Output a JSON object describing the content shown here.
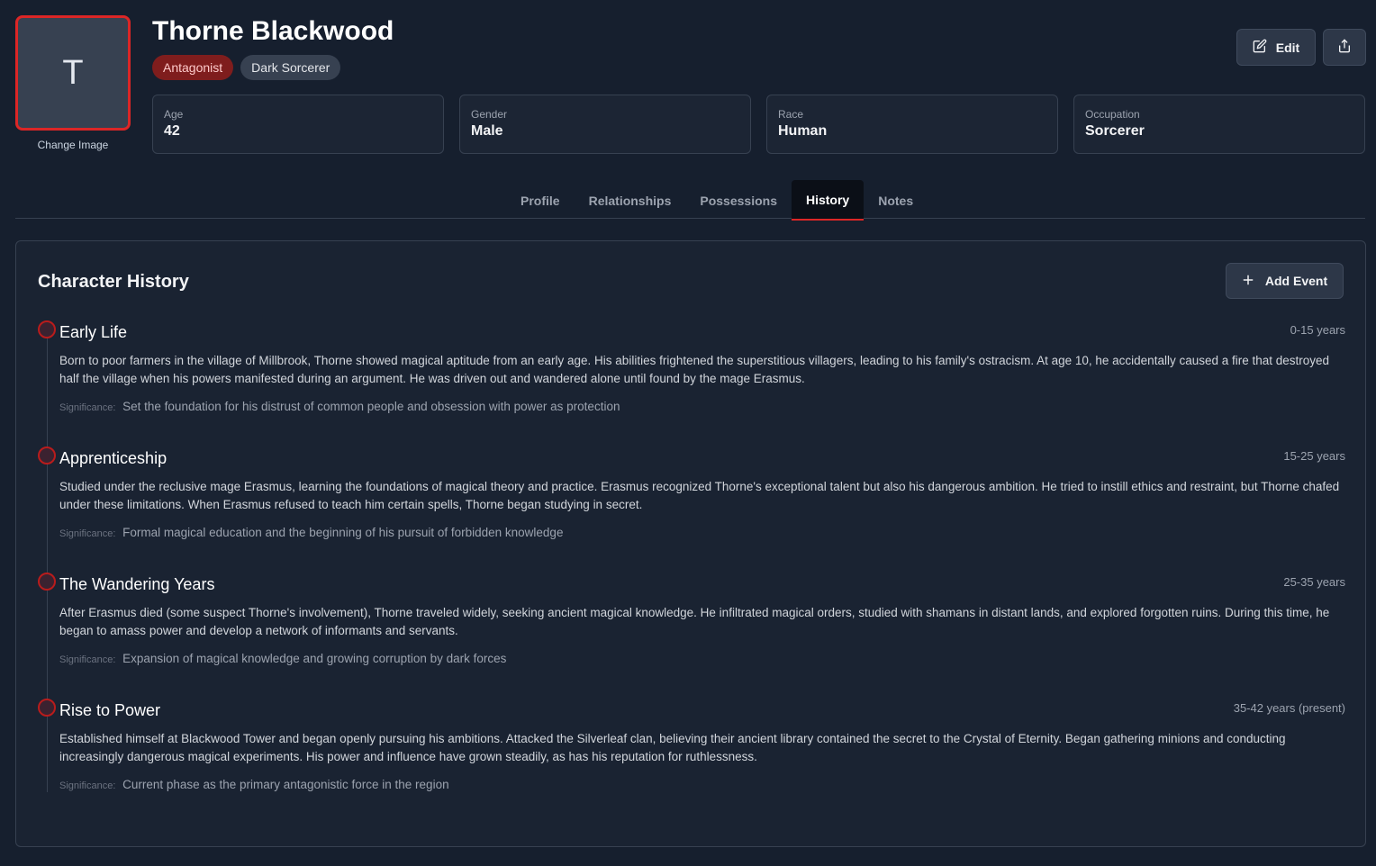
{
  "character": {
    "avatar_initial": "T",
    "change_image": "Change Image",
    "name": "Thorne Blackwood",
    "tags": [
      "Antagonist",
      "Dark Sorcerer"
    ],
    "stats": [
      {
        "label": "Age",
        "value": "42"
      },
      {
        "label": "Gender",
        "value": "Male"
      },
      {
        "label": "Race",
        "value": "Human"
      },
      {
        "label": "Occupation",
        "value": "Sorcerer"
      }
    ]
  },
  "actions": {
    "edit_label": "Edit",
    "edit_icon": "edit-icon",
    "share_icon": "share-icon"
  },
  "tabs": [
    {
      "label": "Profile",
      "active": false
    },
    {
      "label": "Relationships",
      "active": false
    },
    {
      "label": "Possessions",
      "active": false
    },
    {
      "label": "History",
      "active": true
    },
    {
      "label": "Notes",
      "active": false
    }
  ],
  "history": {
    "title": "Character History",
    "add_label": "Add Event",
    "significance_label": "Significance:",
    "events": [
      {
        "title": "Early Life",
        "period": "0-15 years",
        "description": "Born to poor farmers in the village of Millbrook, Thorne showed magical aptitude from an early age. His abilities frightened the superstitious villagers, leading to his family's ostracism. At age 10, he accidentally caused a fire that destroyed half the village when his powers manifested during an argument. He was driven out and wandered alone until found by the mage Erasmus.",
        "significance": "Set the foundation for his distrust of common people and obsession with power as protection"
      },
      {
        "title": "Apprenticeship",
        "period": "15-25 years",
        "description": "Studied under the reclusive mage Erasmus, learning the foundations of magical theory and practice. Erasmus recognized Thorne's exceptional talent but also his dangerous ambition. He tried to instill ethics and restraint, but Thorne chafed under these limitations. When Erasmus refused to teach him certain spells, Thorne began studying in secret.",
        "significance": "Formal magical education and the beginning of his pursuit of forbidden knowledge"
      },
      {
        "title": "The Wandering Years",
        "period": "25-35 years",
        "description": "After Erasmus died (some suspect Thorne's involvement), Thorne traveled widely, seeking ancient magical knowledge. He infiltrated magical orders, studied with shamans in distant lands, and explored forgotten ruins. During this time, he began to amass power and develop a network of informants and servants.",
        "significance": "Expansion of magical knowledge and growing corruption by dark forces"
      },
      {
        "title": "Rise to Power",
        "period": "35-42 years (present)",
        "description": "Established himself at Blackwood Tower and began openly pursuing his ambitions. Attacked the Silverleaf clan, believing their ancient library contained the secret to the Crystal of Eternity. Began gathering minions and conducting increasingly dangerous magical experiments. His power and influence have grown steadily, as has his reputation for ruthlessness.",
        "significance": "Current phase as the primary antagonistic force in the region"
      }
    ]
  },
  "colors": {
    "accent": "#dc2626",
    "background": "#161f2e",
    "panel": "#1a2332"
  }
}
